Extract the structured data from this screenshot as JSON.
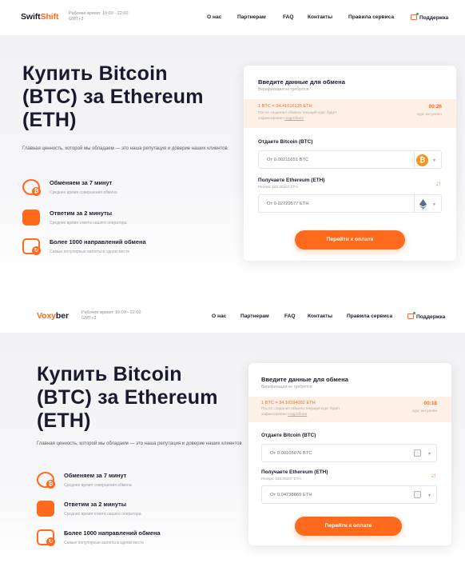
{
  "page1": {
    "brand_main": "Swift",
    "brand_accent": "Shift",
    "worktime_line1": "Рабочее время: 10:00 - 22:00",
    "worktime_line2": "GMT+3",
    "nav": [
      "О нас",
      "Партнерам",
      "FAQ",
      "Контакты",
      "Правила сервиса"
    ],
    "support": "Поддержка",
    "title_line1": "Купить Bitcoin",
    "title_line2": "(BTC) за Ethereum",
    "title_line3": "(ETH)",
    "lead": "Главная ценность, которой мы обладаем — это наша репутация и доверие наших клиентов",
    "features": [
      {
        "title": "Обменяем за 7 минут",
        "sub": "Среднее время совершения обмена"
      },
      {
        "title": "Ответим за 2 минуты",
        "sub": "Среднее время ответа нашего оператора"
      },
      {
        "title": "Более 1000 направлений обмена",
        "sub": "Самые популярные валюты в одном месте"
      }
    ],
    "card": {
      "title": "Введите данные для обмена",
      "subtitle": "Верификация не требуется",
      "rate": "1 BTC = 34.41616135 ETH",
      "rate_note_1": "После создания обмена текущий курс будет",
      "rate_note_2": "зафиксирован",
      "rate_note_link": "подробнее",
      "timer": "00:26",
      "timer_note": "курс актуален",
      "give_label": "Отдаете Bitcoin (BTC)",
      "give_value": "От 0.00211651 BTC",
      "get_label": "Получаете Ethereum (ETH)",
      "reserve": "Резерв: 160.05207 ETH",
      "get_value": "От 0.02729577 ETH",
      "cta": "Перейти к оплате"
    }
  },
  "page2": {
    "brand_main": "Voxy",
    "brand_accent": "ber",
    "worktime_line1": "Рабочее время: 10:00 - 22:00",
    "worktime_line2": "GMT+3",
    "nav": [
      "О нас",
      "Партнерам",
      "FAQ",
      "Контакты",
      "Правила сервиса"
    ],
    "support": "Поддержка",
    "title_line1": "Купить Bitcoin",
    "title_line2": "(BTC) за Ethereum",
    "title_line3": "(ETH)",
    "lead": "Главная ценность, которой мы обладаем — это наша репутация и доверие наших клиентов",
    "features": [
      {
        "title": "Обменяем за 7 минут",
        "sub": "Среднее время совершения обмена"
      },
      {
        "title": "Ответим за 2 минуты",
        "sub": "Среднее время ответа нашего оператора"
      },
      {
        "title": "Более 1000 направлений обмена",
        "sub": "Самые популярные валюты в одном месте"
      }
    ],
    "card": {
      "title": "Введите данные для обмена",
      "subtitle": "Верификация не требуется",
      "rate": "1 BTC = 34.16594092 ETH",
      "rate_note_1": "После создания обмена текущий курс будет",
      "rate_note_2": "зафиксирован",
      "rate_note_link": "подробнее",
      "timer": "00:18",
      "timer_note": "курс актуален",
      "give_label": "Отдаете Bitcoin (BTC)",
      "give_value": "От 0.00105076 BTC",
      "get_label": "Получаете Ethereum (ETH)",
      "reserve": "Резерв: 160.05207 ETH",
      "get_value": "От 0.04738869 ETH",
      "cta": "Перейти к оплате"
    }
  },
  "colors": {
    "accent": "#ff6a1c",
    "text": "#1a1a2e",
    "muted": "#9ba0aa",
    "rate_band": "#fdf0e7"
  },
  "icons": [
    "support-icon",
    "coin-exchange-icon",
    "chat-icon",
    "wallet-icon",
    "btc-icon",
    "eth-icon",
    "swap-arrows-icon",
    "chevron-down-icon",
    "broken-image-icon"
  ]
}
